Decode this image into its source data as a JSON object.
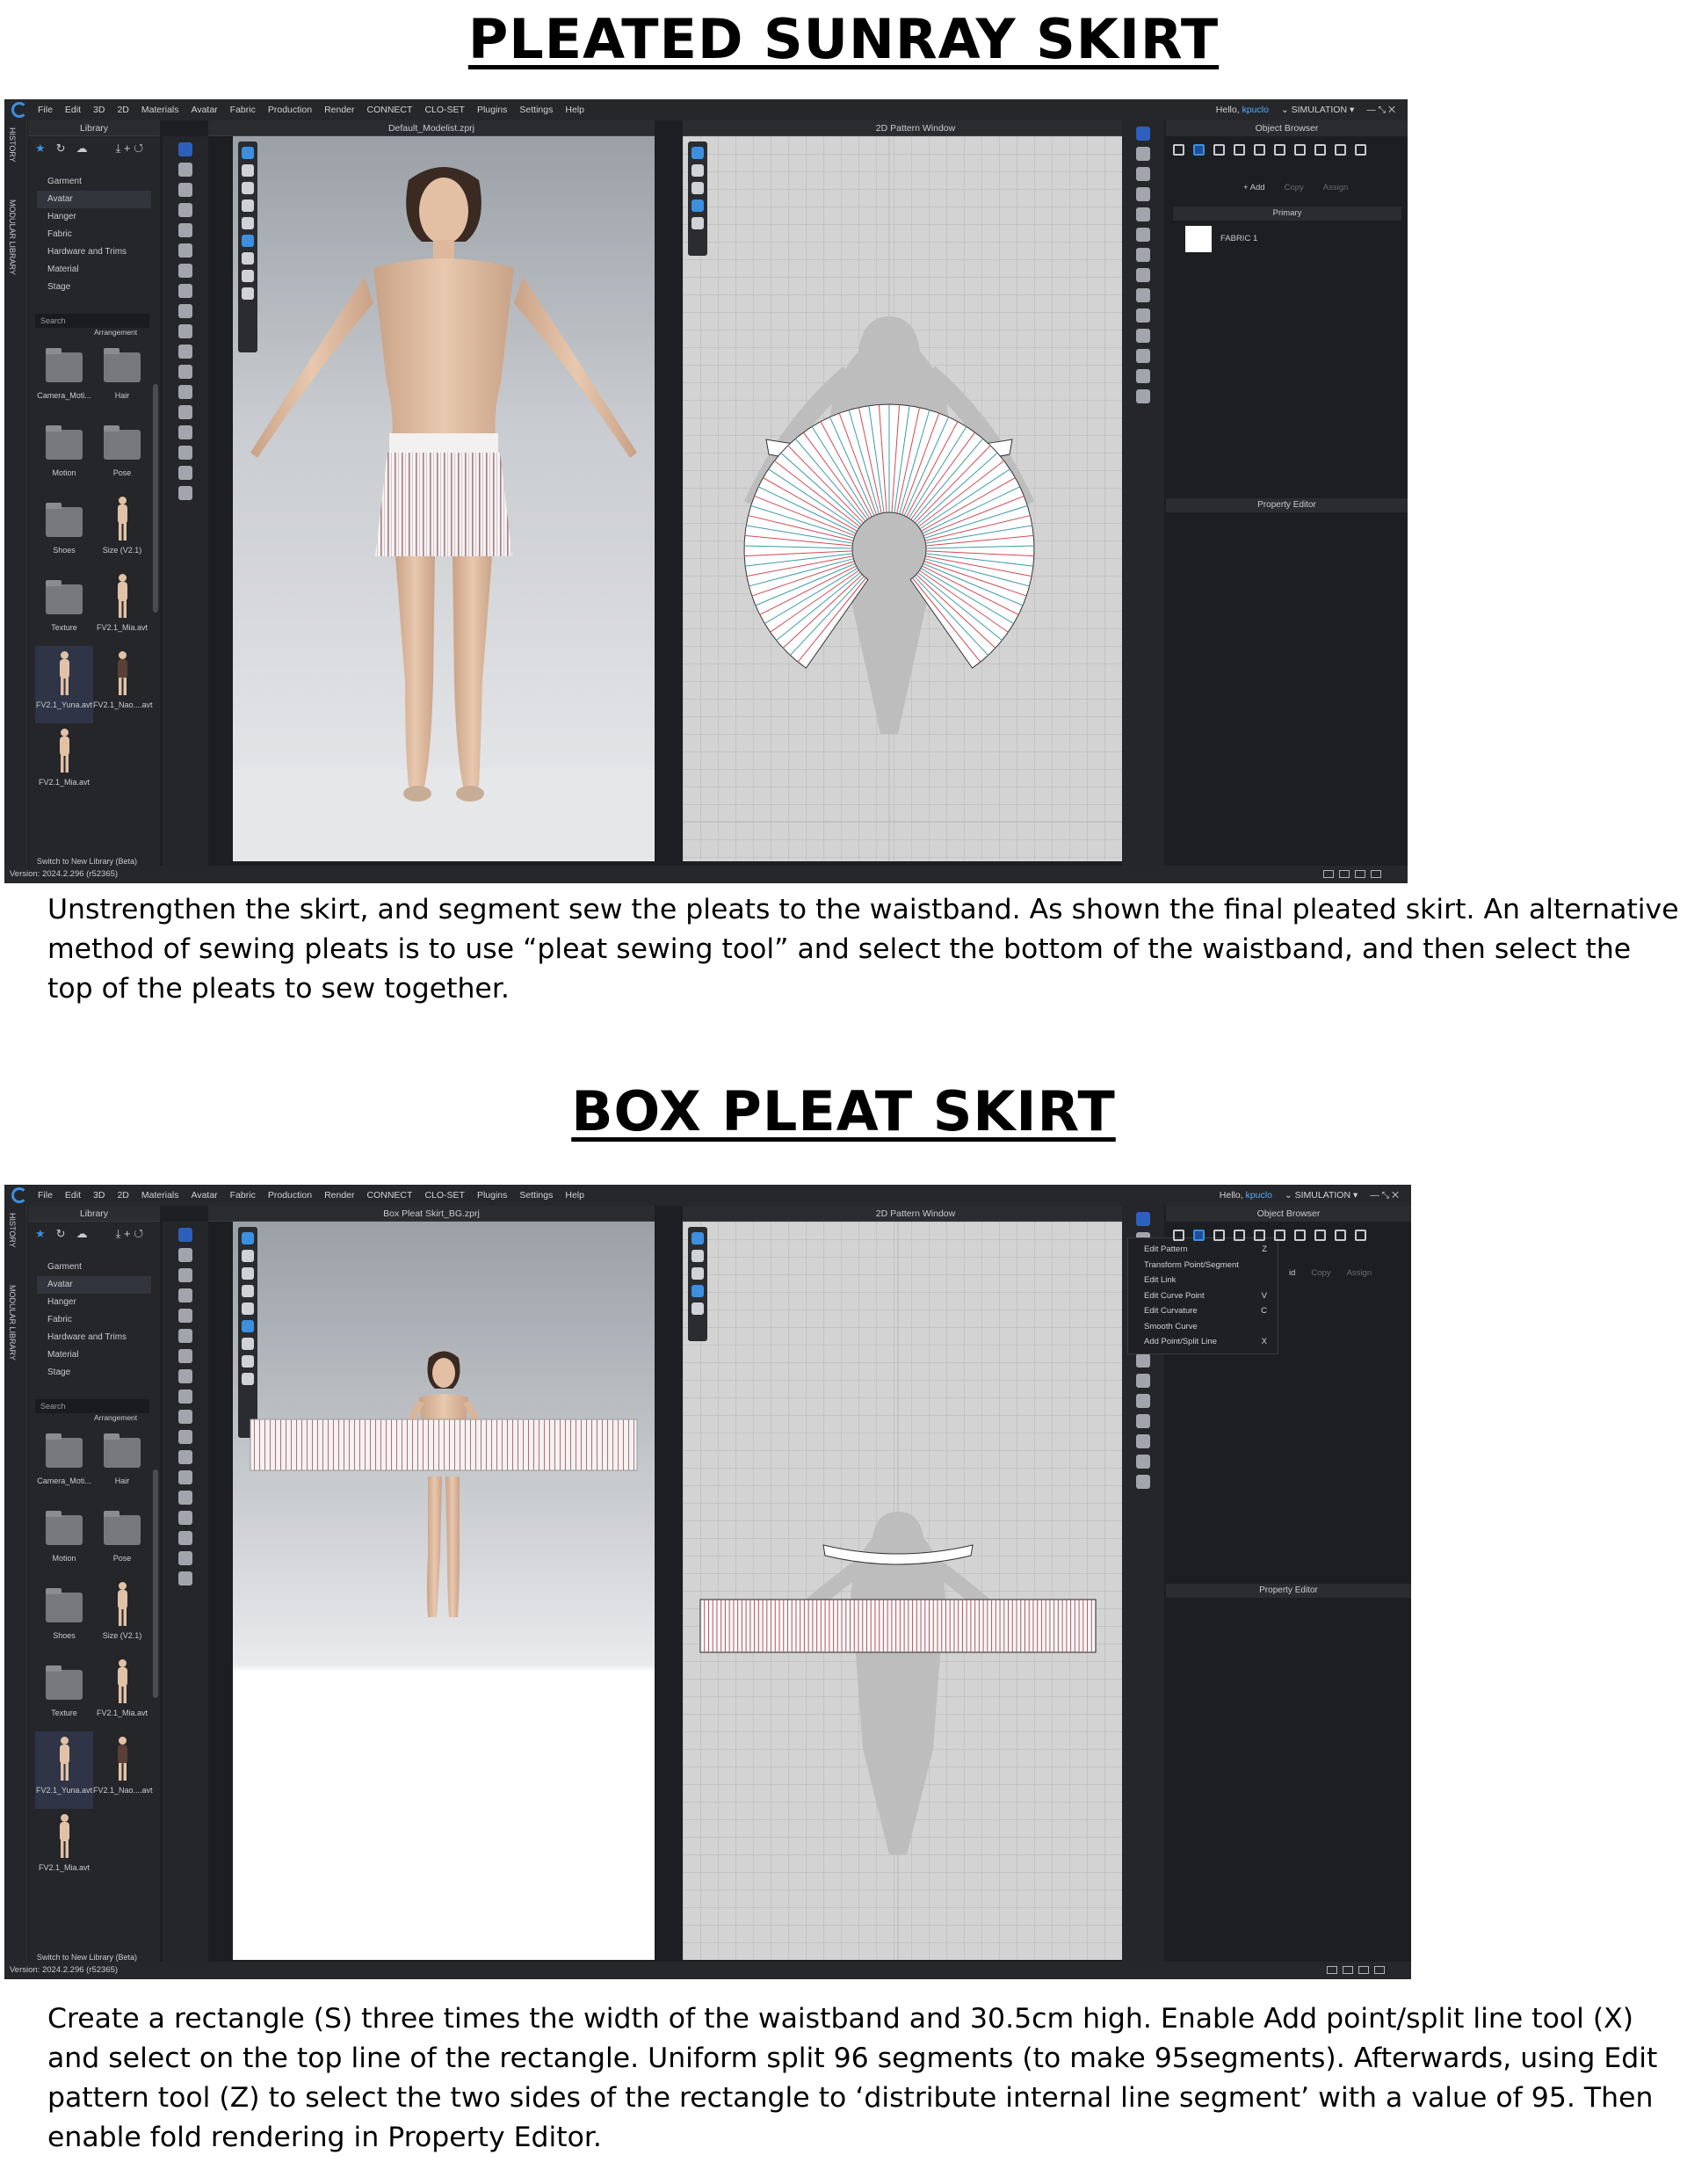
{
  "section1": {
    "heading": "PLEATED SUNRAY SKIRT",
    "paragraph": "Unstrengthen the skirt, and segment sew the pleats to the waistband. As shown the final pleated skirt. An alternative method of sewing pleats is to use “pleat sewing tool” and select the bottom of the waistband, and then select the top of the pleats to sew together.",
    "app": {
      "menu": [
        "File",
        "Edit",
        "3D",
        "2D",
        "Materials",
        "Avatar",
        "Fabric",
        "Production",
        "Render",
        "CONNECT",
        "CLO-SET",
        "Plugins",
        "Settings",
        "Help"
      ],
      "hello": "Hello, ",
      "user": "kpuclo",
      "mode": "SIMULATION",
      "library_title": "Library",
      "side_tabs": [
        "HISTORY",
        "MODULAR LIBRARY"
      ],
      "tree": [
        "Garment",
        "Avatar",
        "Hanger",
        "Fabric",
        "Hardware and Trims",
        "Material",
        "Stage"
      ],
      "search_placeholder": "Search",
      "arrangement": "Arrangement",
      "grid": [
        "Camera_Moti...",
        "Hair",
        "Motion",
        "Pose",
        "Shoes",
        "Size (V2.1)",
        "Texture",
        "FV2.1_Mia.avt",
        "FV2.1_Yuna.avt",
        "FV2.1_Nao....avt",
        "FV2.1_Mia.avt"
      ],
      "switch_label": "Switch to New Library (Beta)",
      "view3d_title": "Default_Modelist.zprj",
      "view2d_title": "2D Pattern Window",
      "object_browser": "Object Browser",
      "add_label": "+ Add",
      "copy_label": "Copy",
      "assign_label": "Assign",
      "primary_label": "Primary",
      "fabric_item": "FABRIC 1",
      "property_editor": "Property Editor",
      "version": "Version: 2024.2.296 (r52365)"
    }
  },
  "section2": {
    "heading": "BOX PLEAT SKIRT",
    "paragraph": "Create a rectangle (S) three times the width of the waistband and 30.5cm high. Enable Add point/split line tool (X) and select on the top line of the rectangle. Uniform split 96 segments (to make 95segments). Afterwards, using Edit pattern tool (Z) to select the two sides of the rectangle to ‘distribute internal line segment’ with a value of 95. Then enable fold rendering in Property Editor.",
    "app": {
      "menu": [
        "File",
        "Edit",
        "3D",
        "2D",
        "Materials",
        "Avatar",
        "Fabric",
        "Production",
        "Render",
        "CONNECT",
        "CLO-SET",
        "Plugins",
        "Settings",
        "Help"
      ],
      "hello": "Hello, ",
      "user": "kpuclo",
      "mode": "SIMULATION",
      "library_title": "Library",
      "side_tabs": [
        "HISTORY",
        "MODULAR LIBRARY"
      ],
      "tree": [
        "Garment",
        "Avatar",
        "Hanger",
        "Fabric",
        "Hardware and Trims",
        "Material",
        "Stage"
      ],
      "search_placeholder": "Search",
      "arrangement": "Arrangement",
      "grid": [
        "Camera_Moti...",
        "Hair",
        "Motion",
        "Pose",
        "Shoes",
        "Size (V2.1)",
        "Texture",
        "FV2.1_Mia.avt",
        "FV2.1_Yuna.avt",
        "FV2.1_Nao....avt",
        "FV2.1_Mia.avt"
      ],
      "switch_label": "Switch to New Library (Beta)",
      "view3d_title": "Box Pleat Skirt_BG.zprj",
      "view2d_title": "2D Pattern Window",
      "object_browser": "Object Browser",
      "add_label": "id",
      "copy_label": "Copy",
      "assign_label": "Assign",
      "property_editor": "Property Editor",
      "version": "Version: 2024.2.296 (r52365)",
      "context_menu": [
        {
          "label": "Edit Pattern",
          "key": "Z"
        },
        {
          "label": "Transform Point/Segment",
          "key": ""
        },
        {
          "label": "Edit Link",
          "key": ""
        },
        {
          "label": "Edit Curve Point",
          "key": "V"
        },
        {
          "label": "Edit Curvature",
          "key": "C"
        },
        {
          "label": "Smooth Curve",
          "key": ""
        },
        {
          "label": "Add Point/Split Line",
          "key": "X"
        }
      ]
    }
  },
  "colors": {
    "accent": "#3d8fe0",
    "ui_bg": "#1d1e21",
    "panel": "#25262a",
    "pattern_bg": "#d3d3d3"
  }
}
